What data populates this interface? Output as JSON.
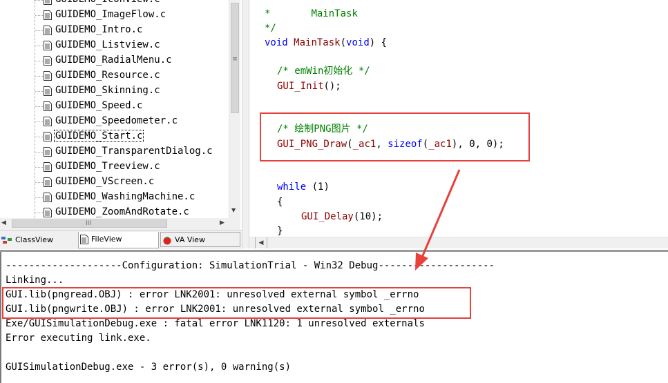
{
  "file_tree": {
    "files": [
      "GUIDEMO_IconView.c",
      "GUIDEMO_ImageFlow.c",
      "GUIDEMO_Intro.c",
      "GUIDEMO_Listview.c",
      "GUIDEMO_RadialMenu.c",
      "GUIDEMO_Resource.c",
      "GUIDEMO_Skinning.c",
      "GUIDEMO_Speed.c",
      "GUIDEMO_Speedometer.c",
      "GUIDEMO_Start.c",
      "GUIDEMO_TransparentDialog.c",
      "GUIDEMO_Treeview.c",
      "GUIDEMO_VScreen.c",
      "GUIDEMO_WashingMachine.c",
      "GUIDEMO_ZoomAndRotate.c"
    ],
    "selected": "GUIDEMO_Start.c",
    "scroll_grip": "≡",
    "hscroll_grip": "III"
  },
  "workspace_tabs": {
    "class_view": "ClassView",
    "file_view": "FileView",
    "va_view": "VA View"
  },
  "editor": {
    "line1_star": "*",
    "line1_name": "MainTask",
    "line2": "*/",
    "line3_kw": "void",
    "line3_fn": "MainTask",
    "line3_open": "(",
    "line3_kw2": "void",
    "line3_close": ") {",
    "comment_init": "/* emWin初始化 */",
    "call_init_fn": "GUI_Init",
    "call_init_rest": "();",
    "comment_png": "/* 绘制PNG图片 */",
    "png_fn": "GUI_PNG_Draw",
    "png_open": "(",
    "png_arg1": "_ac1",
    "png_comma": ", ",
    "png_sizeof": "sizeof",
    "png_paren": "(",
    "png_arg2": "_ac1",
    "png_rest": "), 0, 0);",
    "while_kw": "while",
    "while_rest": " (1)",
    "brace_open": "{",
    "delay_fn": "GUI_Delay",
    "delay_rest": "(10);",
    "brace_close": "}"
  },
  "output": {
    "lines": [
      "--------------------Configuration: SimulationTrial - Win32 Debug--------------------",
      "Linking...",
      "GUI.lib(pngread.OBJ) : error LNK2001: unresolved external symbol _errno",
      "GUI.lib(pngwrite.OBJ) : error LNK2001: unresolved external symbol _errno",
      "Exe/GUISimulationDebug.exe : fatal error LNK1120: 1 unresolved externals",
      "Error executing link.exe.",
      "",
      "GUISimulationDebug.exe - 3 error(s), 0 warning(s)"
    ]
  },
  "colors": {
    "annotation": "#e8403a",
    "comment": "#008000",
    "keyword": "#0000ff",
    "function": "#8b0000"
  }
}
